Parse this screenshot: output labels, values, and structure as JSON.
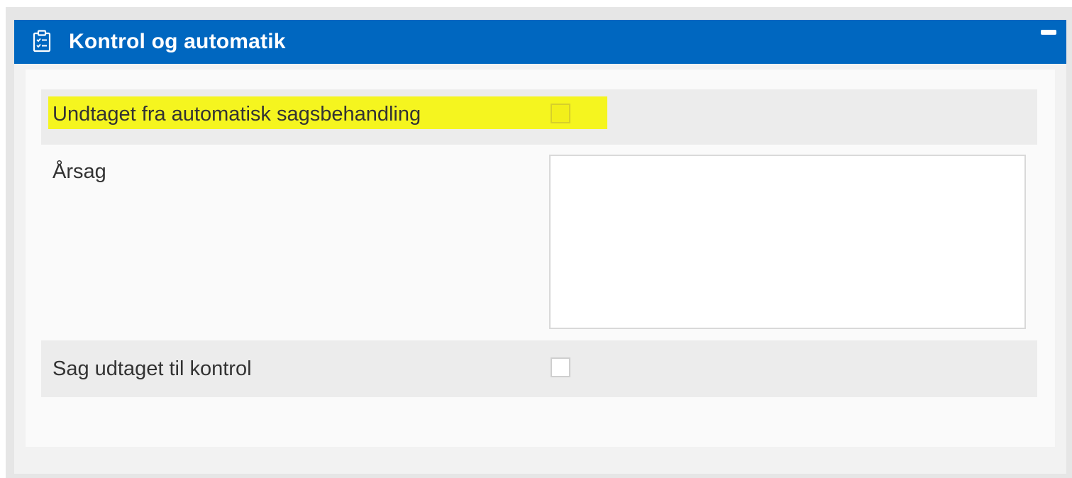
{
  "panel": {
    "title": "Kontrol og automatik",
    "header_icon": "clipboard-checklist-icon",
    "collapse_icon": "minus-icon",
    "colors": {
      "header_bg": "#0067c0",
      "highlight": "#f5f51f"
    }
  },
  "form": {
    "exempt_auto_processing": {
      "label": "Undtaget fra automatisk sagsbehandling",
      "checked": false,
      "highlighted": true
    },
    "reason": {
      "label": "Årsag",
      "value": ""
    },
    "selected_for_control": {
      "label": "Sag udtaget til kontrol",
      "checked": false
    }
  }
}
